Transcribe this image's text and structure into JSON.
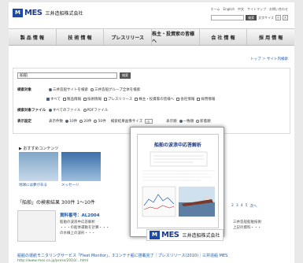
{
  "header": {
    "logo_mark": "M",
    "logo_text": "MES",
    "company_jp": "三井造船株式会社",
    "toplinks": [
      "ホーム",
      "English",
      "中文",
      "サイトマップ",
      "お問い合わせ"
    ],
    "search_btn": "検索",
    "font_size_label": "文字サイズ",
    "font_small": "小",
    "font_large": "大"
  },
  "nav": [
    "製 品 情 報",
    "技 術 情 報",
    "プレスリリース",
    "株主・投資家の皆様へ",
    "会 社 情 報",
    "採 用 情 報"
  ],
  "breadcrumb": "トップ ＞ サイト内検索",
  "search": {
    "query": "船舶",
    "button": "検索",
    "target_label": "検索対象",
    "scope_options": [
      "三井造船サイトを検索",
      "三井造船グループ全体を検索"
    ],
    "category_options": [
      "すべて",
      "製品情報",
      "技術情報",
      "プレスリリース",
      "株主・投資家の皆様へ",
      "会社情報",
      "採用情報"
    ],
    "filetype_label": "検索対象ファイル",
    "filetype_options": [
      "すべてのファイル",
      "PDFファイル"
    ],
    "display_label": "表示設定",
    "count_label": "表示件数",
    "count_options": [
      "10件",
      "20件",
      "50件"
    ],
    "size_label": "検索結果画像サイズ",
    "size_value": "小",
    "order_label": "表示順",
    "order_options": [
      "一致順",
      "新着順"
    ]
  },
  "recommend": {
    "title": "▶ おすすめコンテンツ",
    "items": [
      "地球には夢がある",
      "メッセージ"
    ]
  },
  "results": {
    "summary": "「船舶」の検索結果 300件 1〜10件",
    "pages": [
      "2",
      "3",
      "4",
      "5",
      "次へ"
    ],
    "item1_title": "資料番号：AL2004",
    "item1_snip": [
      "船舶の波浪中応答解析",
      "・・・の船体運動を計算・・・",
      "の水線上の波形・・・"
    ],
    "item1_right": [
      "三井造船船舶技術",
      "上記の資料・・・"
    ],
    "item2_title": "船舶の運航モニタリングサービス「Fleet Monitor」、3コンテナ船に搭載完了｜プレスリリース(2010)｜三井造船 MES",
    "item2_url": "http://www.mes.co.jp/press/2010/...html"
  },
  "popup": {
    "doc_title": "船舶の波浪中応答解析",
    "company": "三井造船株式会社"
  },
  "colors": {
    "brand": "#1e4aa0",
    "link": "#1e5aa8",
    "nav_bg": "#dcdcdc"
  }
}
